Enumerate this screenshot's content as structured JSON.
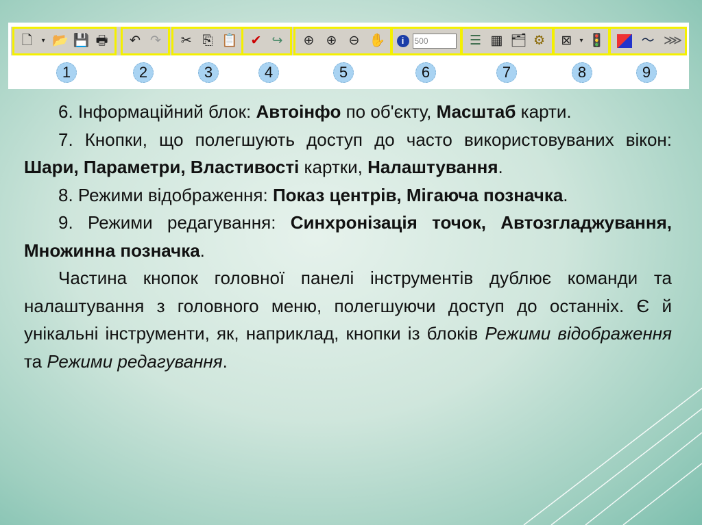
{
  "toolbar": {
    "groups": [
      {
        "number": "1",
        "icons": [
          "new-document-icon",
          "dropdown-arrow-icon",
          "open-folder-icon",
          "save-icon",
          "print-icon"
        ]
      },
      {
        "number": "2",
        "icons": [
          "undo-icon",
          "redo-icon"
        ]
      },
      {
        "number": "3",
        "icons": [
          "cut-icon",
          "copy-icon",
          "paste-icon"
        ]
      },
      {
        "number": "4",
        "icons": [
          "check-icon",
          "repeat-icon"
        ]
      },
      {
        "number": "5",
        "icons": [
          "zoom-area-icon",
          "zoom-in-icon",
          "zoom-out-icon",
          "pan-hand-icon"
        ]
      },
      {
        "number": "6",
        "icons": [
          "info-icon"
        ],
        "scale_value": "500"
      },
      {
        "number": "7",
        "icons": [
          "layers-icon",
          "table-icon",
          "properties-icon",
          "settings-icon"
        ]
      },
      {
        "number": "8",
        "icons": [
          "show-centers-icon",
          "blinking-mark-icon"
        ]
      },
      {
        "number": "9",
        "icons": [
          "sync-points-icon",
          "smoothing-icon",
          "multi-mark-icon"
        ]
      }
    ]
  },
  "paragraphs": {
    "p1": {
      "a": "6. Інформаційний блок: ",
      "b1": "Автоінфо",
      "c": " по об'єкту, ",
      "b2": "Масштаб",
      "d": " карти."
    },
    "p2": {
      "a": "7. Кнопки, що полегшують доступ до часто використовуваних вікон: ",
      "b1": "Шари, Параметри, Властивості",
      "c": " картки, ",
      "b2": "Налаштування",
      "d": "."
    },
    "p3": {
      "a": "8. Режими відображення: ",
      "b1": "Показ центрів, Мігаюча позначка",
      "d": "."
    },
    "p4": {
      "a": "9. Режими редагування: ",
      "b1": "Синхронізація точок, Автозгладжування, Множинна позначка",
      "d": "."
    },
    "p5": {
      "a": "Частина кнопок головної панелі інструментів дублює команди та налаштування з головного меню, полегшуючи доступ до останніх. Є й унікальні інструменти, як, наприклад, кнопки із блоків ",
      "i1": "Режими відображення",
      "c": " та ",
      "i2": "Режими редагування",
      "d": "."
    }
  }
}
